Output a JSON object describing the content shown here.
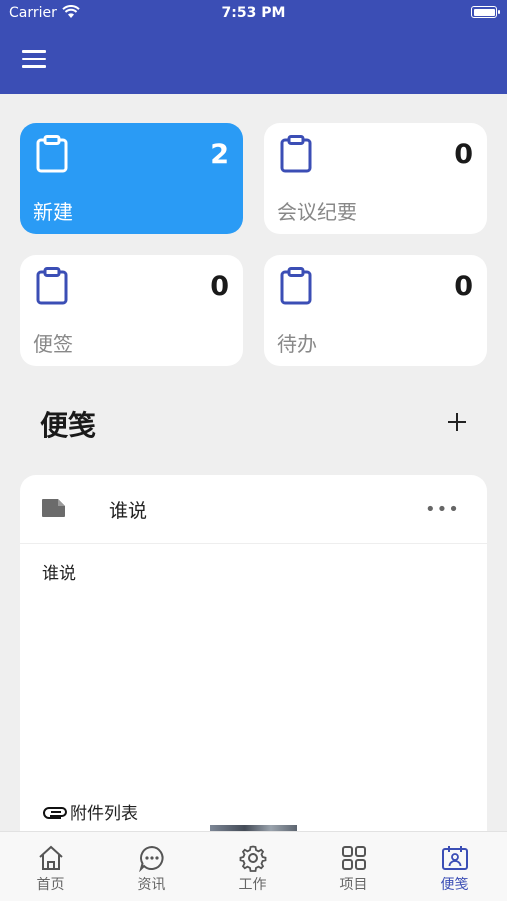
{
  "status_bar": {
    "carrier": "Carrier",
    "time": "7:53 PM"
  },
  "colors": {
    "primary": "#3b4eb5",
    "active_card": "#2a9bf5",
    "background": "#efefef"
  },
  "cards": [
    {
      "label": "新建",
      "count": "2",
      "icon": "clipboard-icon",
      "active": true
    },
    {
      "label": "会议纪要",
      "count": "0",
      "icon": "clipboard-icon",
      "active": false
    },
    {
      "label": "便签",
      "count": "0",
      "icon": "clipboard-icon",
      "active": false
    },
    {
      "label": "待办",
      "count": "0",
      "icon": "clipboard-icon",
      "active": false
    }
  ],
  "section": {
    "title": "便笺",
    "add_icon": "plus-icon"
  },
  "note": {
    "title": "谁说",
    "icon": "note-icon",
    "more_icon": "more-horizontal-icon",
    "more_label": "•••",
    "body": "谁说",
    "attachments_label": "附件列表"
  },
  "tabs": [
    {
      "label": "首页",
      "icon": "home-icon",
      "active": false
    },
    {
      "label": "资讯",
      "icon": "chat-bubble-icon",
      "active": false
    },
    {
      "label": "工作",
      "icon": "gear-icon",
      "active": false
    },
    {
      "label": "项目",
      "icon": "grid-icon",
      "active": false
    },
    {
      "label": "便笺",
      "icon": "calendar-person-icon",
      "active": true
    }
  ]
}
